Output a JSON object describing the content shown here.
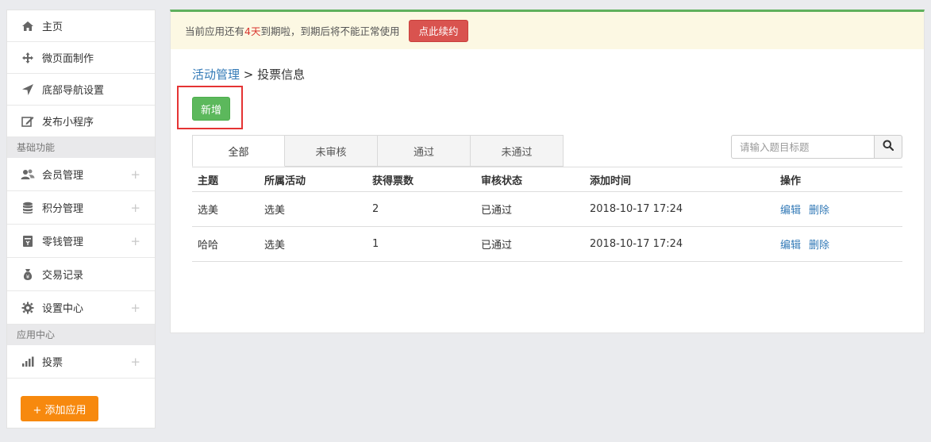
{
  "sidebar": {
    "top_items": [
      {
        "label": "主页",
        "icon": "home-icon"
      },
      {
        "label": "微页面制作",
        "icon": "move-icon"
      },
      {
        "label": "底部导航设置",
        "icon": "navigation-arrow-icon"
      },
      {
        "label": "发布小程序",
        "icon": "edit-icon"
      }
    ],
    "section_basic": "基础功能",
    "basic_items": [
      {
        "label": "会员管理",
        "icon": "users-icon",
        "expand": "+"
      },
      {
        "label": "积分管理",
        "icon": "database-icon",
        "expand": "+"
      },
      {
        "label": "零钱管理",
        "icon": "wallet-icon",
        "expand": "+"
      },
      {
        "label": "交易记录",
        "icon": "money-bag-icon"
      },
      {
        "label": "设置中心",
        "icon": "gear-icon",
        "expand": "+"
      }
    ],
    "section_apps": "应用中心",
    "app_items": [
      {
        "label": "投票",
        "icon": "bar-chart-icon",
        "expand": "+"
      }
    ],
    "add_app_label": "+ 添加应用"
  },
  "notice": {
    "prefix": "当前应用还有",
    "days": "4天",
    "suffix": "到期啦，到期后将不能正常使用",
    "renew_label": "点此续约"
  },
  "breadcrumb": {
    "parent": "活动管理",
    "separator": " > ",
    "current": "投票信息"
  },
  "toolbar": {
    "new_label": "新增"
  },
  "tabs": [
    "全部",
    "未审核",
    "通过",
    "未通过"
  ],
  "search": {
    "placeholder": "请输入题目标题"
  },
  "table": {
    "headers": [
      "主题",
      "所属活动",
      "获得票数",
      "审核状态",
      "添加时间",
      "操作"
    ],
    "rows": [
      {
        "topic": "选美",
        "activity": "选美",
        "votes": "2",
        "status": "已通过",
        "time": "2018-10-17 17:24",
        "edit": "编辑",
        "delete": "删除"
      },
      {
        "topic": "哈哈",
        "activity": "选美",
        "votes": "1",
        "status": "已通过",
        "time": "2018-10-17 17:24",
        "edit": "编辑",
        "delete": "删除"
      }
    ]
  },
  "colors": {
    "accent_green": "#5cb85c",
    "danger_red": "#d9534f",
    "link_blue": "#337ab7",
    "add_orange": "#f7890e",
    "notice_bg": "#fcf8e3"
  }
}
